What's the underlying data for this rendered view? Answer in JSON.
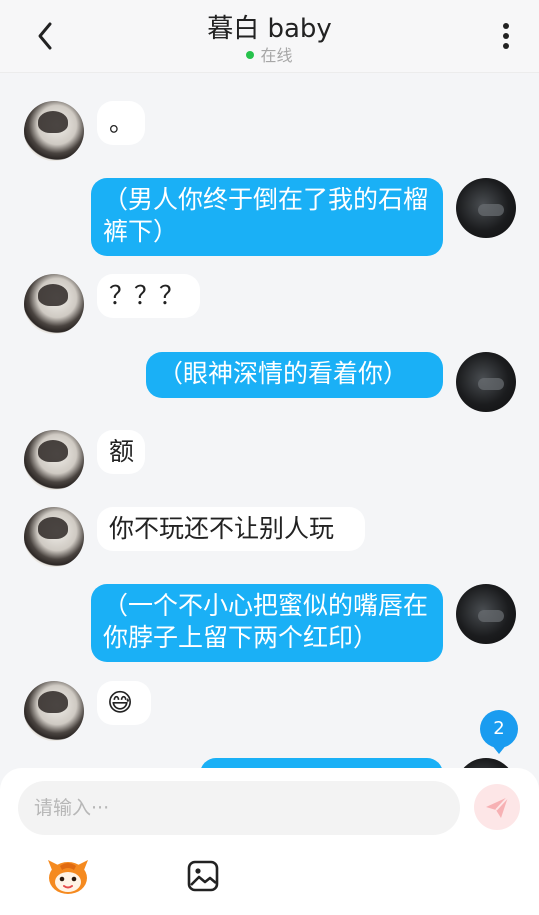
{
  "header": {
    "title": "暮白 baby",
    "status": "在线",
    "back_icon": "chevron-left-icon",
    "more_icon": "more-vertical-icon"
  },
  "messages": [
    {
      "side": "left",
      "text": "。"
    },
    {
      "side": "right",
      "text": "（男人你终于倒在了我的石榴裤下）"
    },
    {
      "side": "left",
      "text": "？？？"
    },
    {
      "side": "right",
      "text": "（眼神深情的看着你）"
    },
    {
      "side": "left",
      "text": "额"
    },
    {
      "side": "left",
      "text": "你不玩还不让别人玩"
    },
    {
      "side": "right",
      "text": "（一个不小心把蜜似的嘴唇在你脖子上留下两个红印）"
    },
    {
      "side": "left",
      "text": "😅"
    }
  ],
  "unread_badge": "2",
  "composer": {
    "placeholder": "请输入···",
    "send_icon": "send-icon",
    "mascot_icon": "mascot-icon",
    "image_icon": "image-icon"
  },
  "colors": {
    "self_bubble": "#1ab0f6",
    "other_bubble": "#ffffff",
    "background": "#f4f5f7",
    "online_dot": "#27c24c",
    "badge": "#1a9cf0"
  }
}
